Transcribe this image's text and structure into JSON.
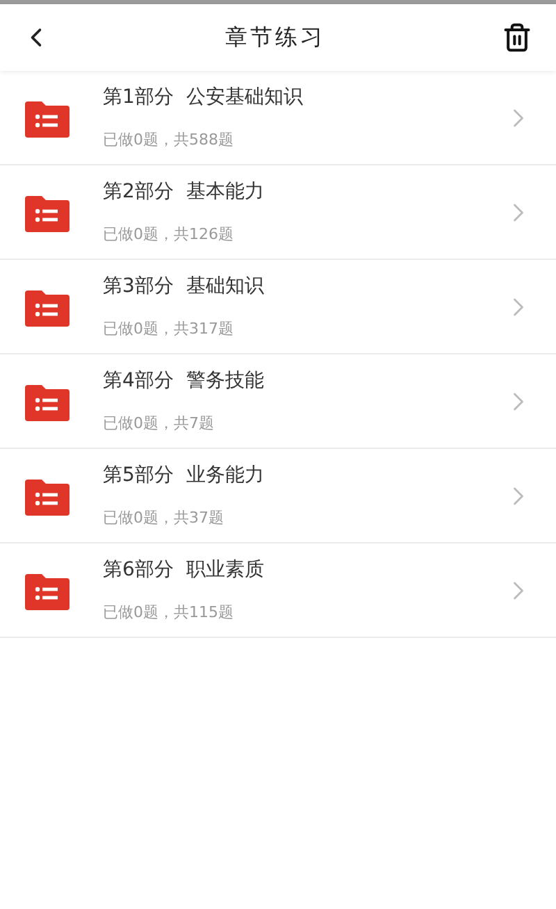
{
  "header": {
    "title": "章节练习"
  },
  "chapters": [
    {
      "part": "第1部分",
      "name": "公安基础知识",
      "progress": "已做0题，共588题"
    },
    {
      "part": "第2部分",
      "name": "基本能力",
      "progress": "已做0题，共126题"
    },
    {
      "part": "第3部分",
      "name": "基础知识",
      "progress": "已做0题，共317题"
    },
    {
      "part": "第4部分",
      "name": "警务技能",
      "progress": "已做0题，共7题"
    },
    {
      "part": "第5部分",
      "name": "业务能力",
      "progress": "已做0题，共37题"
    },
    {
      "part": "第6部分",
      "name": "职业素质",
      "progress": "已做0题，共115题"
    }
  ]
}
